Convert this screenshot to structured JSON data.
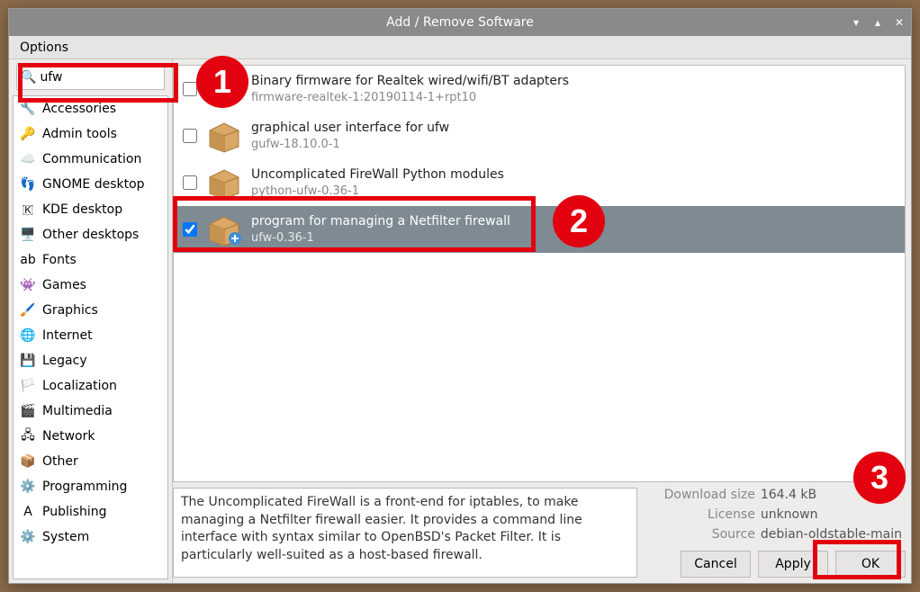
{
  "window_title": "Add / Remove Software",
  "menu": {
    "options": "Options"
  },
  "search": {
    "value": "ufw"
  },
  "categories": [
    {
      "icon": "🔧",
      "label": "Accessories"
    },
    {
      "icon": "🔑",
      "label": "Admin tools"
    },
    {
      "icon": "☁️",
      "label": "Communication"
    },
    {
      "icon": "👣",
      "label": "GNOME desktop"
    },
    {
      "icon": "🇰",
      "label": "KDE desktop"
    },
    {
      "icon": "🖥️",
      "label": "Other desktops"
    },
    {
      "icon": "ab",
      "label": "Fonts"
    },
    {
      "icon": "👾",
      "label": "Games"
    },
    {
      "icon": "🖌️",
      "label": "Graphics"
    },
    {
      "icon": "🌐",
      "label": "Internet"
    },
    {
      "icon": "💾",
      "label": "Legacy"
    },
    {
      "icon": "🏳️",
      "label": "Localization"
    },
    {
      "icon": "🎬",
      "label": "Multimedia"
    },
    {
      "icon": "🖧",
      "label": "Network"
    },
    {
      "icon": "📦",
      "label": "Other"
    },
    {
      "icon": "⚙️",
      "label": "Programming"
    },
    {
      "icon": "A",
      "label": "Publishing"
    },
    {
      "icon": "⚙️",
      "label": "System"
    }
  ],
  "packages": [
    {
      "checked": false,
      "title": "Binary firmware for Realtek wired/wifi/BT adapters",
      "sub": "firmware-realtek-1:20190114-1+rpt10",
      "selected": false
    },
    {
      "checked": false,
      "title": "graphical user interface for ufw",
      "sub": "gufw-18.10.0-1",
      "selected": false
    },
    {
      "checked": false,
      "title": "Uncomplicated FireWall Python modules",
      "sub": "python-ufw-0.36-1",
      "selected": false
    },
    {
      "checked": true,
      "title": "program for managing a Netfilter firewall",
      "sub": "ufw-0.36-1",
      "selected": true
    }
  ],
  "description": "The Uncomplicated FireWall is a front-end for iptables, to make managing a Netfilter firewall easier. It provides a command line interface with syntax similar to OpenBSD's Packet Filter. It is particularly well-suited as a host-based firewall.",
  "meta": {
    "download_label": "Download size",
    "download_value": "164.4 kB",
    "license_label": "License",
    "license_value": "unknown",
    "source_label": "Source",
    "source_value": "debian-oldstable-main"
  },
  "buttons": {
    "cancel": "Cancel",
    "apply": "Apply",
    "ok": "OK"
  },
  "annotations": {
    "1": "1",
    "2": "2",
    "3": "3"
  }
}
